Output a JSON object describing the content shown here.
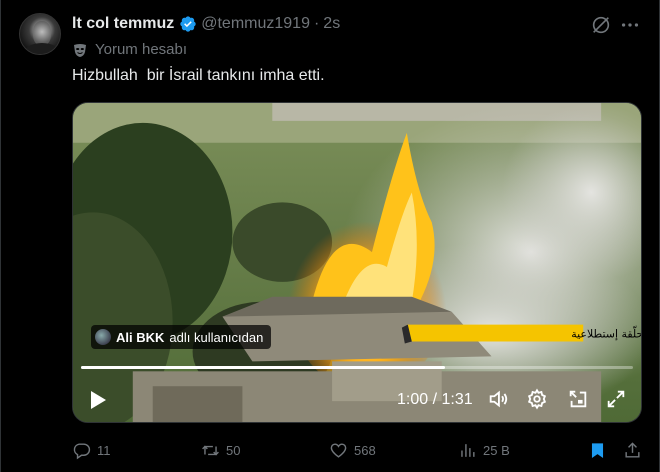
{
  "author": {
    "display_name": "lt col temmuz",
    "handle": "@temmuz1919",
    "time_ago": "2s",
    "separator": "·"
  },
  "account_label": {
    "text": "Yorum hesabı",
    "icon": "mask-icon"
  },
  "tweet": {
    "text": "Hizbullah  bir İsrail tankını imha etti."
  },
  "video": {
    "attribution_user": "Ali BKK",
    "attribution_suffix": "adlı kullanıcıdan",
    "overlay_caption": "تصوير الاستهداف بمحلّقة إستطلاعية",
    "current_time": "1:00",
    "duration": "1:31",
    "time_separator": " / ",
    "progress_fraction": 0.66
  },
  "actions": {
    "replies": "11",
    "reposts": "50",
    "likes": "568",
    "views": "25 B"
  },
  "colors": {
    "background": "#000000",
    "text_primary": "#e7e9ea",
    "text_secondary": "#71767b",
    "verified": "#1d9bf0",
    "bookmark_active": "#1d9bf0",
    "caption_banner": "#f5c400"
  },
  "icons": [
    "verified-badge-icon",
    "grok-icon",
    "more-icon",
    "play-icon",
    "volume-icon",
    "settings-icon",
    "pip-icon",
    "fullscreen-icon",
    "reply-icon",
    "repost-icon",
    "like-icon",
    "views-icon",
    "bookmark-icon",
    "share-icon"
  ]
}
